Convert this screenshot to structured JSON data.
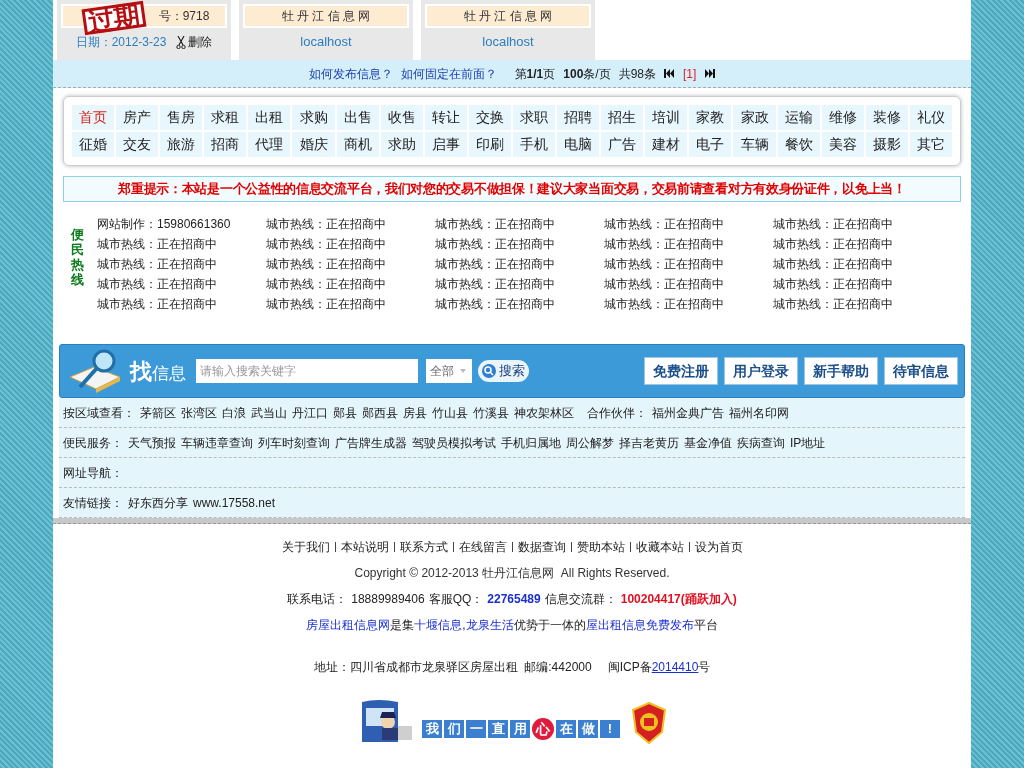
{
  "cards": [
    {
      "kind": "expired",
      "stamp": "过期",
      "title": "号：9718",
      "date": "日期：2012-3-23",
      "action": "删除"
    },
    {
      "kind": "normal",
      "title": "牡 丹 江 信 息 网",
      "link": "localhost"
    },
    {
      "kind": "normal",
      "title": "牡 丹 江 信 息 网",
      "link": "localhost"
    }
  ],
  "pager": {
    "help_links": [
      "如何发布信息？",
      "如何固定在前面？"
    ],
    "page_prefix": "第",
    "page": "1/1",
    "page_suffix": "页",
    "per_page": "100",
    "per_page_suffix": "条/页",
    "total": "共98条",
    "pages": [
      {
        "label": "[1]",
        "selected": true
      }
    ]
  },
  "categories": [
    {
      "label": "首页",
      "selected": true
    },
    {
      "label": "房产",
      "selected": false
    },
    {
      "label": "售房",
      "selected": false
    },
    {
      "label": "求租",
      "selected": false
    },
    {
      "label": "出租",
      "selected": false
    },
    {
      "label": "求购",
      "selected": false
    },
    {
      "label": "出售",
      "selected": false
    },
    {
      "label": "收售",
      "selected": false
    },
    {
      "label": "转让",
      "selected": false
    },
    {
      "label": "交换",
      "selected": false
    },
    {
      "label": "求职",
      "selected": false
    },
    {
      "label": "招聘",
      "selected": false
    },
    {
      "label": "招生",
      "selected": false
    },
    {
      "label": "培训",
      "selected": false
    },
    {
      "label": "家教",
      "selected": false
    },
    {
      "label": "家政",
      "selected": false
    },
    {
      "label": "运输",
      "selected": false
    },
    {
      "label": "维修",
      "selected": false
    },
    {
      "label": "装修",
      "selected": false
    },
    {
      "label": "礼仪",
      "selected": false
    },
    {
      "label": "征婚",
      "selected": false
    },
    {
      "label": "交友",
      "selected": false
    },
    {
      "label": "旅游",
      "selected": false
    },
    {
      "label": "招商",
      "selected": false
    },
    {
      "label": "代理",
      "selected": false
    },
    {
      "label": "婚庆",
      "selected": false
    },
    {
      "label": "商机",
      "selected": false
    },
    {
      "label": "求助",
      "selected": false
    },
    {
      "label": "启事",
      "selected": false
    },
    {
      "label": "印刷",
      "selected": false
    },
    {
      "label": "手机",
      "selected": false
    },
    {
      "label": "电脑",
      "selected": false
    },
    {
      "label": "广告",
      "selected": false
    },
    {
      "label": "建材",
      "selected": false
    },
    {
      "label": "电子",
      "selected": false
    },
    {
      "label": "车辆",
      "selected": false
    },
    {
      "label": "餐饮",
      "selected": false
    },
    {
      "label": "美容",
      "selected": false
    },
    {
      "label": "摄影",
      "selected": false
    },
    {
      "label": "其它",
      "selected": false
    }
  ],
  "notice": "郑重提示：本站是一个公益性的信息交流平台，我们对您的交易不做担保！建议大家当面交易，交易前请查看对方有效身份证件，以免上当！",
  "hotlines": {
    "title": "便民热线",
    "items": [
      "网站制作：15980661360",
      "城市热线：正在招商中",
      "城市热线：正在招商中",
      "城市热线：正在招商中",
      "城市热线：正在招商中",
      "城市热线：正在招商中",
      "城市热线：正在招商中",
      "城市热线：正在招商中",
      "城市热线：正在招商中",
      "城市热线：正在招商中",
      "城市热线：正在招商中",
      "城市热线：正在招商中",
      "城市热线：正在招商中",
      "城市热线：正在招商中",
      "城市热线：正在招商中",
      "城市热线：正在招商中",
      "城市热线：正在招商中",
      "城市热线：正在招商中",
      "城市热线：正在招商中",
      "城市热线：正在招商中",
      "城市热线：正在招商中",
      "城市热线：正在招商中",
      "城市热线：正在招商中",
      "城市热线：正在招商中",
      "城市热线：正在招商中"
    ]
  },
  "search": {
    "title_big": "找",
    "title_small": "信息",
    "placeholder": "请输入搜索关键字",
    "scope": "全部",
    "button": "搜索",
    "actions": [
      "免费注册",
      "用户登录",
      "新手帮助",
      "待审信息"
    ]
  },
  "link_rows": [
    {
      "label": "按区域查看：",
      "links": [
        "茅箭区",
        "张湾区",
        "白浪",
        "武当山",
        "丹江口",
        "郧县",
        "郧西县",
        "房县",
        "竹山县",
        "竹溪县",
        "神农架林区"
      ],
      "extra_label": "合作伙伴：",
      "extra_links": [
        "福州金典广告",
        "福州名印网"
      ]
    },
    {
      "label": "便民服务：",
      "links": [
        "天气预报",
        "车辆违章查询",
        "列车时刻查询",
        "广告牌生成器",
        "驾驶员模拟考试",
        "手机归属地",
        "周公解梦",
        "择吉老黄历",
        "基金净值",
        "疾病查询",
        "IP地址"
      ]
    },
    {
      "label": "网址导航："
    },
    {
      "label": "友情链接：",
      "links": [
        "好东西分享",
        "www.17558.net"
      ]
    }
  ],
  "footer": {
    "links": [
      "关于我们",
      "本站说明",
      "联系方式",
      "在线留言",
      "数据查询",
      "赞助本站",
      "收藏本站",
      "设为首页"
    ],
    "copyright": "Copyright © 2012-2013 牡丹江信息网  All Rights Reserved.",
    "phone_label": "联系电话：",
    "phone": "18889989406",
    "qq_label": "客服QQ：",
    "qq": "22765489",
    "group_label": "信息交流群：",
    "group": "100204417",
    "group_join": "(踊跃加入)",
    "promo": [
      {
        "text": "房屋出租信息网",
        "link": true
      },
      {
        "text": "是集",
        "link": false
      },
      {
        "text": "十堰信息",
        "link": true
      },
      {
        "text": ",",
        "link": false
      },
      {
        "text": "龙泉生活",
        "link": true
      },
      {
        "text": "优势于一体的",
        "link": false
      },
      {
        "text": "屋出租信息免费发布",
        "link": true
      },
      {
        "text": "平台",
        "link": false
      }
    ],
    "address": "地址：四川省成都市龙泉驿区房屋出租  邮编:442000",
    "icp_prefix": "闽ICP备",
    "icp_number": "2014410",
    "icp_suffix": "号",
    "badge": [
      "我",
      "们",
      "一",
      "直",
      "用",
      "心",
      "在",
      "做",
      "!"
    ]
  }
}
